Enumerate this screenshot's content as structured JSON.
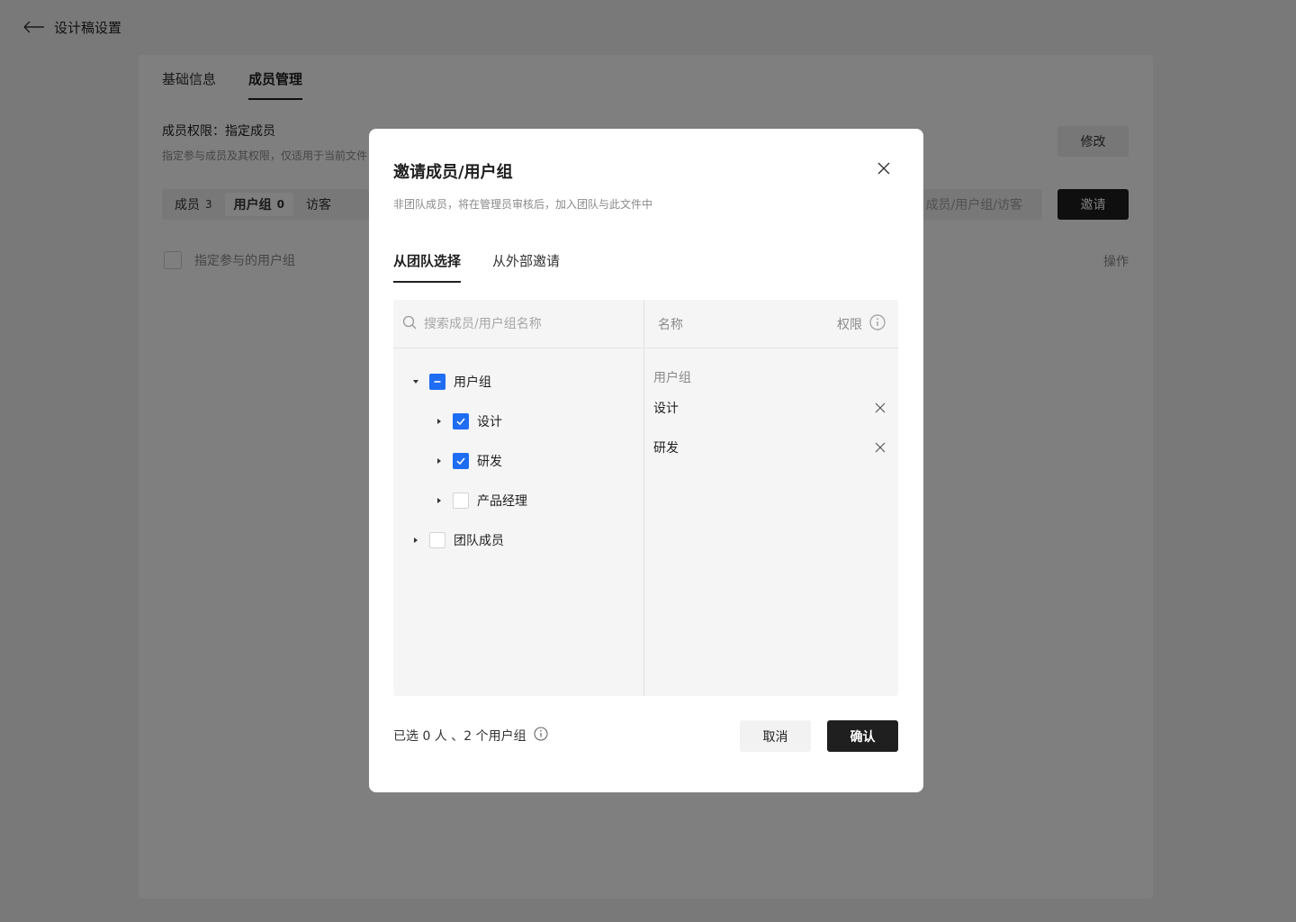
{
  "topbar": {
    "title": "设计稿设置",
    "back_icon": "arrow-left-icon"
  },
  "settings_tabs": [
    {
      "label": "基础信息",
      "active": false
    },
    {
      "label": "成员管理",
      "active": true
    }
  ],
  "permission": {
    "title": "成员权限：指定成员",
    "description": "指定参与成员及其权限，仅适用于当前文件",
    "modify_label": "修改"
  },
  "segments": [
    {
      "label": "成员",
      "count": "3",
      "active": false
    },
    {
      "label": "用户组",
      "count": "0",
      "active": true
    },
    {
      "label": "访客",
      "count": "",
      "active": false
    }
  ],
  "bg_search": {
    "placeholder": "成员/用户组/访客"
  },
  "invite_label": "邀请",
  "list": {
    "header_label": "指定参与的用户组",
    "op_label": "操作"
  },
  "modal": {
    "title": "邀请成员/用户组",
    "subtitle": "非团队成员，将在管理员审核后，加入团队与此文件中",
    "tabs": [
      {
        "label": "从团队选择",
        "active": true
      },
      {
        "label": "从外部邀请",
        "active": false
      }
    ],
    "search_placeholder": "搜索成员/用户组名称",
    "tree": [
      {
        "label": "用户组",
        "level": 0,
        "state": "partial",
        "expanded": true
      },
      {
        "label": "设计",
        "level": 1,
        "state": "checked",
        "expanded": false
      },
      {
        "label": "研发",
        "level": 1,
        "state": "checked",
        "expanded": false
      },
      {
        "label": "产品经理",
        "level": 1,
        "state": "unchecked",
        "expanded": false
      },
      {
        "label": "团队成员",
        "level": 0,
        "state": "unchecked",
        "expanded": false
      }
    ],
    "right": {
      "col_name": "名称",
      "col_perm": "权限",
      "section_label": "用户组",
      "selected": [
        "设计",
        "研发"
      ]
    },
    "footer": {
      "summary": "已选 0 人 、2 个用户组",
      "cancel": "取消",
      "confirm": "确认"
    }
  },
  "colors": {
    "accent": "#1f6df2",
    "primary_button": "#1f1f1f",
    "overlay": "rgba(0,0,0,0.5)"
  }
}
